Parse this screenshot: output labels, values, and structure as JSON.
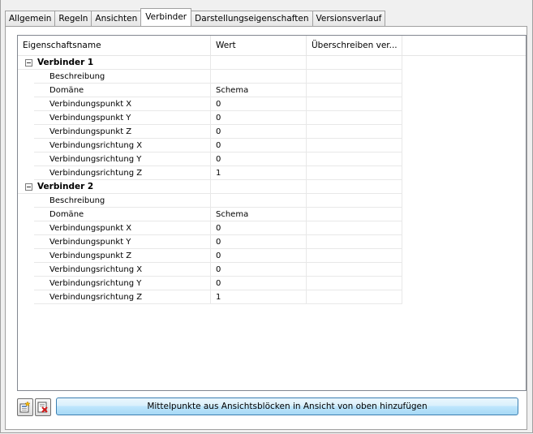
{
  "tabs": [
    {
      "label": "Allgemein",
      "active": false
    },
    {
      "label": "Regeln",
      "active": false
    },
    {
      "label": "Ansichten",
      "active": false
    },
    {
      "label": "Verbinder",
      "active": true
    },
    {
      "label": "Darstellungseigenschaften",
      "active": false
    },
    {
      "label": "Versionsverlauf",
      "active": false
    }
  ],
  "grid": {
    "columns": [
      "Eigenschaftsname",
      "Wert",
      "Überschreiben ver..."
    ],
    "groups": [
      {
        "name": "Verbinder 1",
        "expanded": true,
        "rows": [
          {
            "name": "Beschreibung",
            "value": ""
          },
          {
            "name": "Domäne",
            "value": "Schema"
          },
          {
            "name": "Verbindungspunkt X",
            "value": "0"
          },
          {
            "name": "Verbindungspunkt Y",
            "value": "0"
          },
          {
            "name": "Verbindungspunkt Z",
            "value": "0"
          },
          {
            "name": "Verbindungsrichtung X",
            "value": "0"
          },
          {
            "name": "Verbindungsrichtung Y",
            "value": "0"
          },
          {
            "name": "Verbindungsrichtung Z",
            "value": "1"
          }
        ]
      },
      {
        "name": "Verbinder 2",
        "expanded": true,
        "rows": [
          {
            "name": "Beschreibung",
            "value": ""
          },
          {
            "name": "Domäne",
            "value": "Schema"
          },
          {
            "name": "Verbindungspunkt X",
            "value": "0"
          },
          {
            "name": "Verbindungspunkt Y",
            "value": "0"
          },
          {
            "name": "Verbindungspunkt Z",
            "value": "0"
          },
          {
            "name": "Verbindungsrichtung X",
            "value": "0"
          },
          {
            "name": "Verbindungsrichtung Y",
            "value": "0"
          },
          {
            "name": "Verbindungsrichtung Z",
            "value": "1"
          }
        ]
      }
    ]
  },
  "buttons": {
    "add_icon": "add-connector-icon",
    "delete_icon": "delete-connector-icon",
    "main_label": "Mittelpunkte aus Ansichtsblöcken in Ansicht von oben hinzufügen"
  }
}
